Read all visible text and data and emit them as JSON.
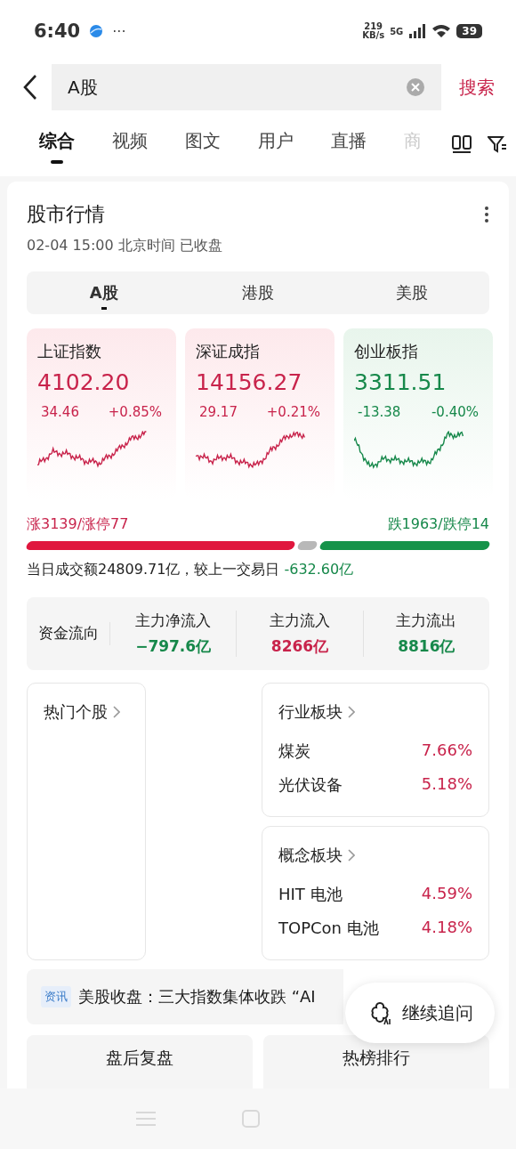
{
  "status_bar": {
    "time": "6:40",
    "more": "···",
    "speed": "219",
    "speed_unit": "KB/s",
    "network": "5G",
    "battery": "39"
  },
  "search": {
    "value": "A股",
    "action": "搜索"
  },
  "tabs": [
    {
      "label": "综合",
      "selected": true
    },
    {
      "label": "视频",
      "selected": false
    },
    {
      "label": "图文",
      "selected": false
    },
    {
      "label": "用户",
      "selected": false
    },
    {
      "label": "直播",
      "selected": false
    },
    {
      "label": "商",
      "selected": false
    }
  ],
  "market_card": {
    "title": "股市行情",
    "subtitle": "02-04 15:00 北京时间 已收盘",
    "markets": [
      {
        "label": "A股",
        "selected": true
      },
      {
        "label": "港股",
        "selected": false
      },
      {
        "label": "美股",
        "selected": false
      }
    ],
    "indices": [
      {
        "name": "上证指数",
        "value": "4102.20",
        "change": "34.46",
        "percent": "+0.85%",
        "kind": "up"
      },
      {
        "name": "深证成指",
        "value": "14156.27",
        "change": "29.17",
        "percent": "+0.21%",
        "kind": "up"
      },
      {
        "name": "创业板指",
        "value": "3311.51",
        "change": "-13.38",
        "percent": "-0.40%",
        "kind": "down"
      }
    ],
    "rise_text": "涨3139/涨停77",
    "fall_text": "跌1963/跌停14",
    "turnover": {
      "text": "当日成交额24809.71亿，较上一交易日",
      "delta": "-632.60亿"
    },
    "fund_flow": {
      "label": "资金流向",
      "items": [
        {
          "label": "主力净流入",
          "value": "−797.6亿",
          "kind": "down"
        },
        {
          "label": "主力流入",
          "value": "8266亿",
          "kind": "up"
        },
        {
          "label": "主力流出",
          "value": "8816亿",
          "kind": "down"
        }
      ]
    },
    "hot_stocks": {
      "title": "热门个股"
    },
    "sector_boards": [
      {
        "title": "行业板块",
        "rows": [
          {
            "name": "煤炭",
            "value": "7.66%"
          },
          {
            "name": "光伏设备",
            "value": "5.18%"
          }
        ]
      },
      {
        "title": "概念板块",
        "rows": [
          {
            "name": "HIT 电池",
            "value": "4.59%"
          },
          {
            "name": "TOPCon 电池",
            "value": "4.18%"
          }
        ]
      }
    ],
    "news": {
      "tag": "资讯",
      "text": "美股收盘：三大指数集体收跌 “AI"
    },
    "buttons": [
      "盘后复盘",
      "热榜排行"
    ]
  },
  "floating_button": {
    "label": "继续追问"
  }
}
